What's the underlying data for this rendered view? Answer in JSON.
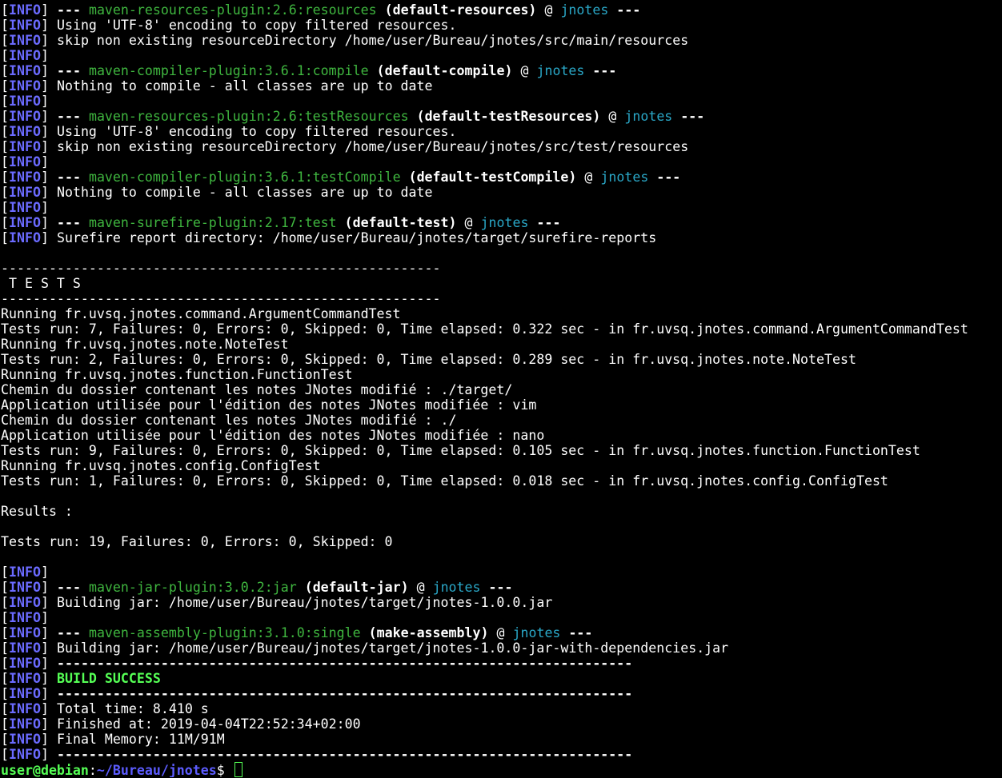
{
  "colors": {
    "background": "#000000",
    "text": "#ffffff",
    "info_tag": "#6b6bff",
    "plugin": "#3fb63f",
    "artifact": "#2aa8c8",
    "success": "#55ff55",
    "prompt_user": "#55ff55",
    "prompt_path": "#5c5cff"
  },
  "lines": [
    {
      "type": "mojo",
      "plugin": "maven-resources-plugin:2.6:resources",
      "goal": "(default-resources)",
      "artifact": "jnotes"
    },
    {
      "type": "info",
      "text": "Using 'UTF-8' encoding to copy filtered resources."
    },
    {
      "type": "info",
      "text": "skip non existing resourceDirectory /home/user/Bureau/jnotes/src/main/resources"
    },
    {
      "type": "info",
      "text": ""
    },
    {
      "type": "mojo",
      "plugin": "maven-compiler-plugin:3.6.1:compile",
      "goal": "(default-compile)",
      "artifact": "jnotes"
    },
    {
      "type": "info",
      "text": "Nothing to compile - all classes are up to date"
    },
    {
      "type": "info",
      "text": ""
    },
    {
      "type": "mojo",
      "plugin": "maven-resources-plugin:2.6:testResources",
      "goal": "(default-testResources)",
      "artifact": "jnotes"
    },
    {
      "type": "info",
      "text": "Using 'UTF-8' encoding to copy filtered resources."
    },
    {
      "type": "info",
      "text": "skip non existing resourceDirectory /home/user/Bureau/jnotes/src/test/resources"
    },
    {
      "type": "info",
      "text": ""
    },
    {
      "type": "mojo",
      "plugin": "maven-compiler-plugin:3.6.1:testCompile",
      "goal": "(default-testCompile)",
      "artifact": "jnotes"
    },
    {
      "type": "info",
      "text": "Nothing to compile - all classes are up to date"
    },
    {
      "type": "info",
      "text": ""
    },
    {
      "type": "mojo",
      "plugin": "maven-surefire-plugin:2.17:test",
      "goal": "(default-test)",
      "artifact": "jnotes"
    },
    {
      "type": "info",
      "text": "Surefire report directory: /home/user/Bureau/jnotes/target/surefire-reports"
    },
    {
      "type": "plain",
      "text": ""
    },
    {
      "type": "plain",
      "text": "-------------------------------------------------------"
    },
    {
      "type": "plain",
      "text": " T E S T S"
    },
    {
      "type": "plain",
      "text": "-------------------------------------------------------"
    },
    {
      "type": "plain",
      "text": "Running fr.uvsq.jnotes.command.ArgumentCommandTest"
    },
    {
      "type": "plain",
      "text": "Tests run: 7, Failures: 0, Errors: 0, Skipped: 0, Time elapsed: 0.322 sec - in fr.uvsq.jnotes.command.ArgumentCommandTest"
    },
    {
      "type": "plain",
      "text": "Running fr.uvsq.jnotes.note.NoteTest"
    },
    {
      "type": "plain",
      "text": "Tests run: 2, Failures: 0, Errors: 0, Skipped: 0, Time elapsed: 0.289 sec - in fr.uvsq.jnotes.note.NoteTest"
    },
    {
      "type": "plain",
      "text": "Running fr.uvsq.jnotes.function.FunctionTest"
    },
    {
      "type": "plain",
      "text": "Chemin du dossier contenant les notes JNotes modifié : ./target/"
    },
    {
      "type": "plain",
      "text": "Application utilisée pour l'édition des notes JNotes modifiée : vim"
    },
    {
      "type": "plain",
      "text": "Chemin du dossier contenant les notes JNotes modifié : ./"
    },
    {
      "type": "plain",
      "text": "Application utilisée pour l'édition des notes JNotes modifiée : nano"
    },
    {
      "type": "plain",
      "text": "Tests run: 9, Failures: 0, Errors: 0, Skipped: 0, Time elapsed: 0.105 sec - in fr.uvsq.jnotes.function.FunctionTest"
    },
    {
      "type": "plain",
      "text": "Running fr.uvsq.jnotes.config.ConfigTest"
    },
    {
      "type": "plain",
      "text": "Tests run: 1, Failures: 0, Errors: 0, Skipped: 0, Time elapsed: 0.018 sec - in fr.uvsq.jnotes.config.ConfigTest"
    },
    {
      "type": "plain",
      "text": ""
    },
    {
      "type": "plain",
      "text": "Results :"
    },
    {
      "type": "plain",
      "text": ""
    },
    {
      "type": "plain",
      "text": "Tests run: 19, Failures: 0, Errors: 0, Skipped: 0"
    },
    {
      "type": "plain",
      "text": ""
    },
    {
      "type": "info",
      "text": ""
    },
    {
      "type": "mojo",
      "plugin": "maven-jar-plugin:3.0.2:jar",
      "goal": "(default-jar)",
      "artifact": "jnotes"
    },
    {
      "type": "info",
      "text": "Building jar: /home/user/Bureau/jnotes/target/jnotes-1.0.0.jar"
    },
    {
      "type": "info",
      "text": ""
    },
    {
      "type": "mojo",
      "plugin": "maven-assembly-plugin:3.1.0:single",
      "goal": "(make-assembly)",
      "artifact": "jnotes"
    },
    {
      "type": "info",
      "text": "Building jar: /home/user/Bureau/jnotes/target/jnotes-1.0.0-jar-with-dependencies.jar"
    },
    {
      "type": "info-bold",
      "text": "------------------------------------------------------------------------"
    },
    {
      "type": "success",
      "text": "BUILD SUCCESS"
    },
    {
      "type": "info-bold",
      "text": "------------------------------------------------------------------------"
    },
    {
      "type": "info",
      "text": "Total time: 8.410 s"
    },
    {
      "type": "info",
      "text": "Finished at: 2019-04-04T22:52:34+02:00"
    },
    {
      "type": "info",
      "text": "Final Memory: 11M/91M"
    },
    {
      "type": "info-bold",
      "text": "------------------------------------------------------------------------"
    }
  ],
  "log_tokens": {
    "tag": "INFO",
    "open_bracket": "[",
    "close_bracket": "]",
    "mojo_dashes": "---",
    "at_sign": "@"
  },
  "prompt": {
    "user_host": "user@debian",
    "separator": ":",
    "path": "~/Bureau/jnotes",
    "symbol": "$"
  }
}
